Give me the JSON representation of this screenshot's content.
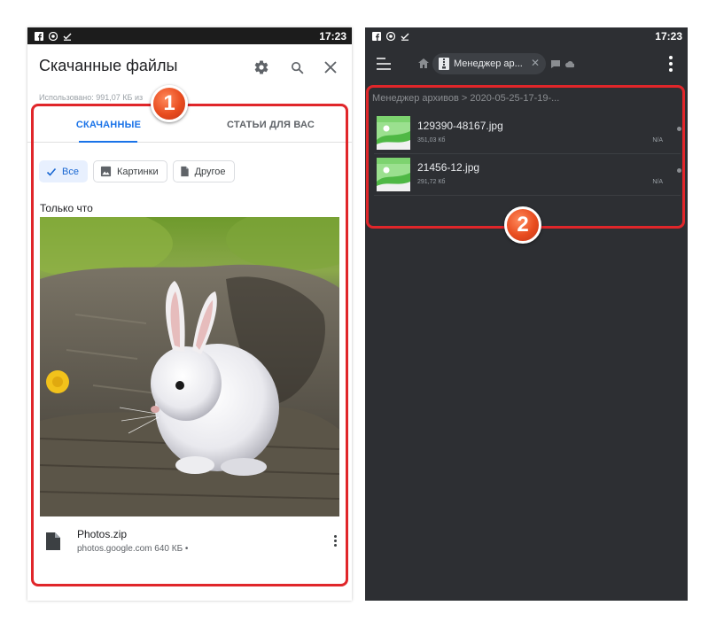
{
  "left_phone": {
    "status": {
      "time": "17:23"
    },
    "header": {
      "title": "Скачанные файлы"
    },
    "storage_text": "Использовано: 991,07 КБ из",
    "tabs": [
      {
        "label": "СКАЧАННЫЕ",
        "active": true
      },
      {
        "label": "СТАТЬИ ДЛЯ ВАС",
        "active": false
      }
    ],
    "chips": [
      {
        "label": "Все",
        "icon": "check-icon",
        "selected": true
      },
      {
        "label": "Картинки",
        "icon": "image-icon",
        "selected": false
      },
      {
        "label": "Другое",
        "icon": "document-icon",
        "selected": false
      }
    ],
    "section_label": "Только что",
    "file": {
      "name": "Photos.zip",
      "meta": "photos.google.com 640 КБ •"
    },
    "badge": "1",
    "colors": {
      "accent": "#1a73e8",
      "highlight": "#e0262a"
    }
  },
  "right_phone": {
    "status": {
      "time": "17:23"
    },
    "toolbar": {
      "tab_label": "Менеджер ар...",
      "tab_close": "✕"
    },
    "breadcrumb": "Менеджер архивов > 2020-05-25-17-19-...",
    "files": [
      {
        "name": "129390-48167.jpg",
        "size": "351,03 Кб",
        "date": "N/A"
      },
      {
        "name": "21456-12.jpg",
        "size": "291,72 Кб",
        "date": "N/A"
      }
    ],
    "badge": "2",
    "colors": {
      "background": "#2d2f33",
      "highlight": "#e0262a"
    }
  }
}
